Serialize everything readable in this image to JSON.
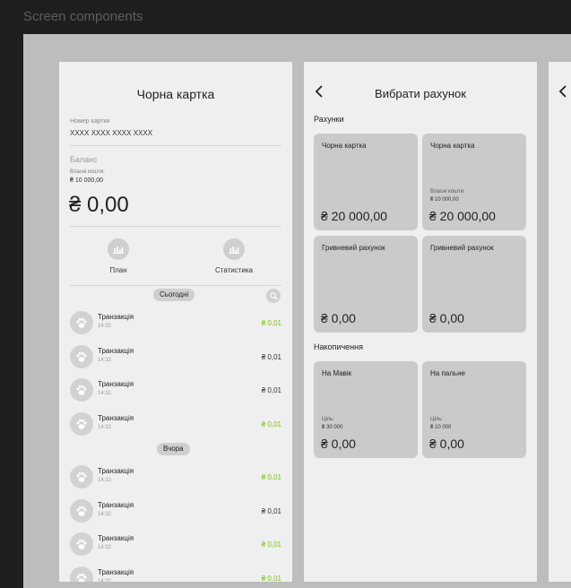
{
  "topbar": {
    "title": "Screen components"
  },
  "screen1": {
    "title": "Чорна картка",
    "card_label": "Номер картки",
    "card_number": "XXXX XXXX XXXX XXXX",
    "balance_label": "Баланс",
    "own_funds_label": "Власні кошти:",
    "own_funds_value": "₴ 10 000,00",
    "balance_value": "₴ 0,00",
    "actions": [
      {
        "label": "План",
        "icon": "bar-chart-icon"
      },
      {
        "label": "Статистика",
        "icon": "bar-chart-icon"
      }
    ],
    "groups": [
      {
        "label": "Сьогодні",
        "items": [
          {
            "name": "Транзакція",
            "time": "14:32",
            "amount": "₴ 0,01",
            "positive": true
          },
          {
            "name": "Транзакція",
            "time": "14:32",
            "amount": "₴ 0,01",
            "positive": false
          },
          {
            "name": "Транзакція",
            "time": "14:32",
            "amount": "₴ 0,01",
            "positive": false
          },
          {
            "name": "Транзакція",
            "time": "14:32",
            "amount": "₴ 0,01",
            "positive": true
          }
        ]
      },
      {
        "label": "Вчора",
        "items": [
          {
            "name": "Транзакція",
            "time": "14:32",
            "amount": "₴ 0,01",
            "positive": true
          },
          {
            "name": "Транзакція",
            "time": "14:32",
            "amount": "₴ 0,01",
            "positive": false
          },
          {
            "name": "Транзакція",
            "time": "14:32",
            "amount": "₴ 0,01",
            "positive": true
          },
          {
            "name": "Транзакція",
            "time": "14:32",
            "amount": "₴ 0,01",
            "positive": true
          }
        ]
      }
    ],
    "colors": {
      "positive": "#7dbe1e",
      "neutral": "#333333"
    }
  },
  "screen2": {
    "title": "Вибрати рахунок",
    "accounts_section": "Рахунки",
    "accounts": [
      {
        "name": "Чорна картка",
        "amount": "₴ 20 000,00"
      },
      {
        "name": "Чорна картка",
        "sublabel": "Власні кошти:",
        "subvalue": "₴ 10 000,00",
        "amount": "₴ 20 000,00"
      },
      {
        "name": "Гривневий рахунок",
        "amount": "₴ 0,00"
      },
      {
        "name": "Гривневий рахунок",
        "amount": "₴ 0,00"
      }
    ],
    "savings_section": "Накопичення",
    "savings": [
      {
        "name": "На Мавік",
        "sublabel": "Ціль:",
        "subvalue": "₴ 30 000",
        "amount": "₴ 0,00"
      },
      {
        "name": "На пальне",
        "sublabel": "Ціль:",
        "subvalue": "₴ 10 000",
        "amount": "₴ 0,00"
      }
    ]
  }
}
